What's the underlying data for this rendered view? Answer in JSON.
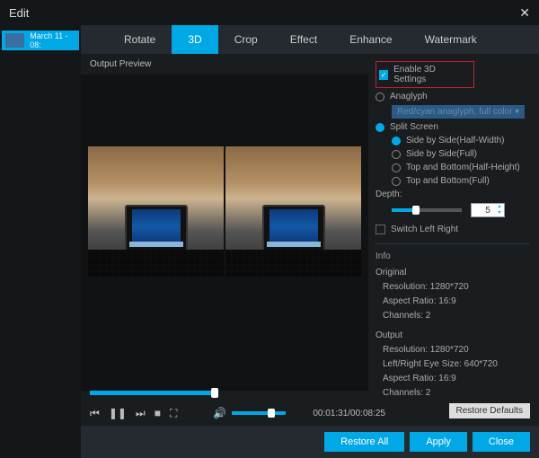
{
  "title": "Edit",
  "sidebar": {
    "thumb_date": "March 11 - 08:"
  },
  "tabs": [
    {
      "label": "Rotate"
    },
    {
      "label": "3D"
    },
    {
      "label": "Crop"
    },
    {
      "label": "Effect"
    },
    {
      "label": "Enhance"
    },
    {
      "label": "Watermark"
    }
  ],
  "preview": {
    "label": "Output Preview",
    "time": "00:01:31/00:08:25"
  },
  "settings": {
    "enable": "Enable 3D Settings",
    "anaglyph": "Anaglyph",
    "anaglyph_mode": "Red/cyan anaglyph, full color",
    "split": "Split Screen",
    "opts": {
      "sbs_half": "Side by Side(Half-Width)",
      "sbs_full": "Side by Side(Full)",
      "tb_half": "Top and Bottom(Half-Height)",
      "tb_full": "Top and Bottom(Full)"
    },
    "depth_label": "Depth:",
    "depth_value": "5",
    "switch": "Switch Left Right"
  },
  "info": {
    "title": "Info",
    "original": {
      "heading": "Original",
      "resolution": "Resolution: 1280*720",
      "aspect": "Aspect Ratio: 16:9",
      "channels": "Channels: 2"
    },
    "output": {
      "heading": "Output",
      "resolution": "Resolution: 1280*720",
      "eye": "Left/Right Eye Size: 640*720",
      "aspect": "Aspect Ratio: 16:9",
      "channels": "Channels: 2"
    }
  },
  "buttons": {
    "restore_defaults": "Restore Defaults",
    "restore_all": "Restore All",
    "apply": "Apply",
    "close": "Close"
  }
}
